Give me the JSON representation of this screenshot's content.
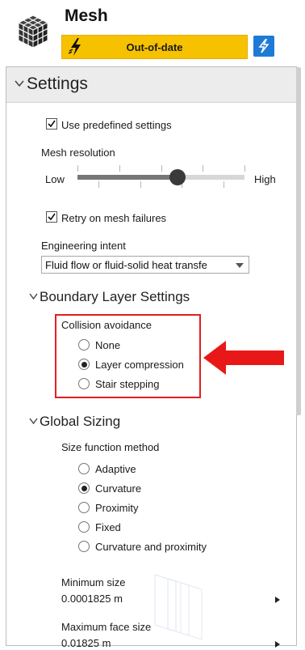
{
  "header": {
    "title": "Mesh",
    "status": "Out-of-date",
    "accent": "#f6c200",
    "update_button_color": "#1f7ad6"
  },
  "settings": {
    "title": "Settings",
    "use_predefined": {
      "label": "Use predefined settings",
      "checked": true
    },
    "mesh_resolution": {
      "label": "Mesh resolution",
      "low": "Low",
      "high": "High",
      "value": 0.6
    },
    "retry": {
      "label": "Retry on mesh failures",
      "checked": true
    },
    "engineering_intent": {
      "label": "Engineering intent",
      "value": "Fluid flow or fluid-solid heat transfe"
    }
  },
  "boundary_layer": {
    "title": "Boundary Layer Settings",
    "collision_label": "Collision avoidance",
    "options": [
      {
        "label": "None",
        "selected": false
      },
      {
        "label": "Layer compression",
        "selected": true
      },
      {
        "label": "Stair stepping",
        "selected": false
      }
    ],
    "highlight_color": "#e02020"
  },
  "global_sizing": {
    "title": "Global Sizing",
    "method_label": "Size function method",
    "methods": [
      {
        "label": "Adaptive",
        "selected": false
      },
      {
        "label": "Curvature",
        "selected": true
      },
      {
        "label": "Proximity",
        "selected": false
      },
      {
        "label": "Fixed",
        "selected": false
      },
      {
        "label": "Curvature and proximity",
        "selected": false
      }
    ],
    "min_size": {
      "label": "Minimum size",
      "value": "0.0001825 m"
    },
    "max_face_size": {
      "label": "Maximum face size",
      "value": "0.01825 m"
    }
  }
}
